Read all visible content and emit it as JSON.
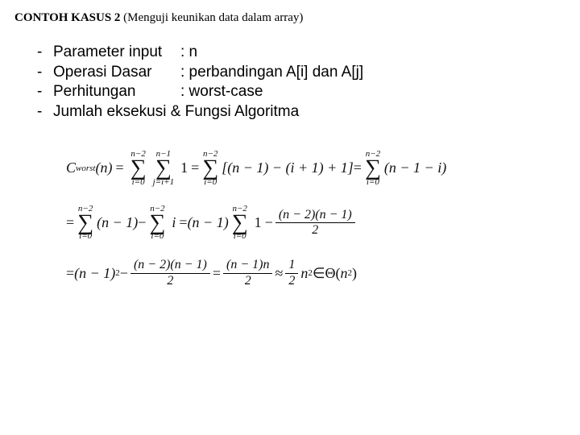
{
  "title": {
    "bold": "CONTOH KASUS 2",
    "rest": " (Menguji keunikan data dalam array)"
  },
  "bullets": [
    {
      "label": "Parameter input",
      "value": ": n"
    },
    {
      "label": "Operasi Dasar",
      "value": ": perbandingan A[i] dan A[j]"
    },
    {
      "label": "Perhitungan",
      "value": ": worst-case"
    },
    {
      "label": "Jumlah eksekusi & Fungsi Algoritma",
      "value": ""
    }
  ],
  "math": {
    "cworst": "C",
    "worst_sub": "worst",
    "n_arg": "(n)",
    "sum1_top": "n−2",
    "sum1_bot": "i=0",
    "sum2_top": "n−1",
    "sum2_bot": "j=i+1",
    "one": "1",
    "eq": " = ",
    "minus": " − ",
    "approx": " ≈ ",
    "in": " ∈ ",
    "bracket_expr": "[(n − 1) − (i + 1) + 1]",
    "n_minus_1_minus_i": "(n − 1 − i)",
    "n_minus_1": "(n − 1)",
    "i_term": "i",
    "frac_a_num": "(n − 2)(n − 1)",
    "frac_a_den": "2",
    "sq_nm1": "(n − 1)",
    "sq_sup": "2",
    "frac_b_num": "(n − 1)n",
    "frac_b_den": "2",
    "half_num": "1",
    "half_den": "2",
    "n2": "n",
    "n2_sup": "2",
    "theta_open": "Θ(",
    "theta_n": "n",
    "theta_sup": "2",
    "theta_close": ")"
  }
}
